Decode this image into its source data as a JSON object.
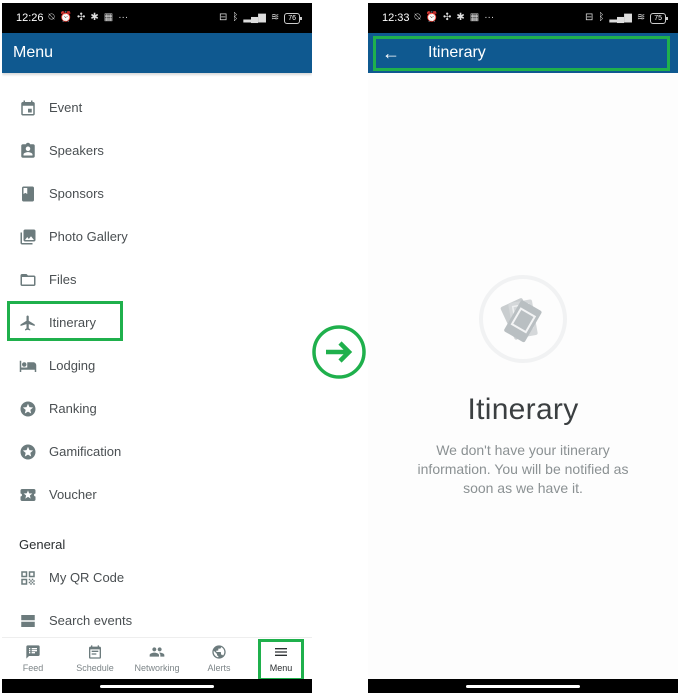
{
  "left_screen": {
    "status_bar": {
      "time": "12:26",
      "battery": "76"
    },
    "app_bar": {
      "title": "Menu"
    },
    "menu_items": [
      {
        "label": "Event",
        "icon": "calendar-icon"
      },
      {
        "label": "Speakers",
        "icon": "badge-icon"
      },
      {
        "label": "Sponsors",
        "icon": "book-icon"
      },
      {
        "label": "Photo Gallery",
        "icon": "photo-library-icon"
      },
      {
        "label": "Files",
        "icon": "folder-icon"
      },
      {
        "label": "Itinerary",
        "icon": "airplane-icon",
        "highlighted": true
      },
      {
        "label": "Lodging",
        "icon": "bed-icon"
      },
      {
        "label": "Ranking",
        "icon": "star-circle-icon"
      },
      {
        "label": "Gamification",
        "icon": "star-circle-icon"
      },
      {
        "label": "Voucher",
        "icon": "ticket-star-icon"
      }
    ],
    "general_section": {
      "title": "General",
      "items": [
        {
          "label": "My QR Code",
          "icon": "qr-code-icon"
        },
        {
          "label": "Search events",
          "icon": "list-icon"
        }
      ]
    },
    "bottom_nav": [
      {
        "label": "Feed",
        "icon": "feed-icon"
      },
      {
        "label": "Schedule",
        "icon": "schedule-icon"
      },
      {
        "label": "Networking",
        "icon": "people-icon"
      },
      {
        "label": "Alerts",
        "icon": "globe-icon"
      },
      {
        "label": "Menu",
        "icon": "hamburger-icon",
        "active": true
      }
    ]
  },
  "transition": {
    "icon": "arrow-right-circle-icon",
    "color": "#1fb04c"
  },
  "right_screen": {
    "status_bar": {
      "time": "12:33",
      "battery": "75"
    },
    "app_bar": {
      "title": "Itinerary",
      "back_icon": "arrow-left-icon"
    },
    "empty_state": {
      "icon": "tickets-icon",
      "title": "Itinerary",
      "message": "We don't have your itinerary information. You will be notified as soon as we have it."
    }
  },
  "colors": {
    "app_bar": "#0f5990",
    "highlight": "#1fb04c",
    "icon": "#6c7b7d"
  }
}
